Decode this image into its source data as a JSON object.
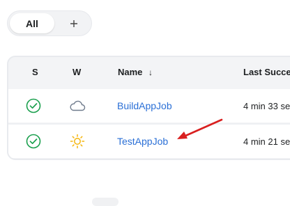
{
  "view_tabs": {
    "all_label": "All",
    "add_label": "+"
  },
  "table": {
    "headers": {
      "status": "S",
      "weather": "W",
      "name": "Name",
      "name_sort": "↓",
      "last_success": "Last Succe"
    },
    "rows": [
      {
        "status": "success",
        "weather": "cloudy",
        "name": "BuildAppJob",
        "last_success": "4 min 33 se"
      },
      {
        "status": "success",
        "weather": "sunny",
        "name": "TestAppJob",
        "last_success": "4 min 21 se"
      }
    ]
  },
  "colors": {
    "success": "#1a9f4d",
    "link": "#2a6fd6",
    "sun": "#f5b50a",
    "cloud": "#6f7b8c",
    "annotation_arrow": "#d91f1f"
  },
  "icons": {
    "status": "check-circle-icon",
    "weather_row1": "cloud-icon",
    "weather_row2": "sun-icon",
    "annotation": "red-arrow-annotation"
  }
}
